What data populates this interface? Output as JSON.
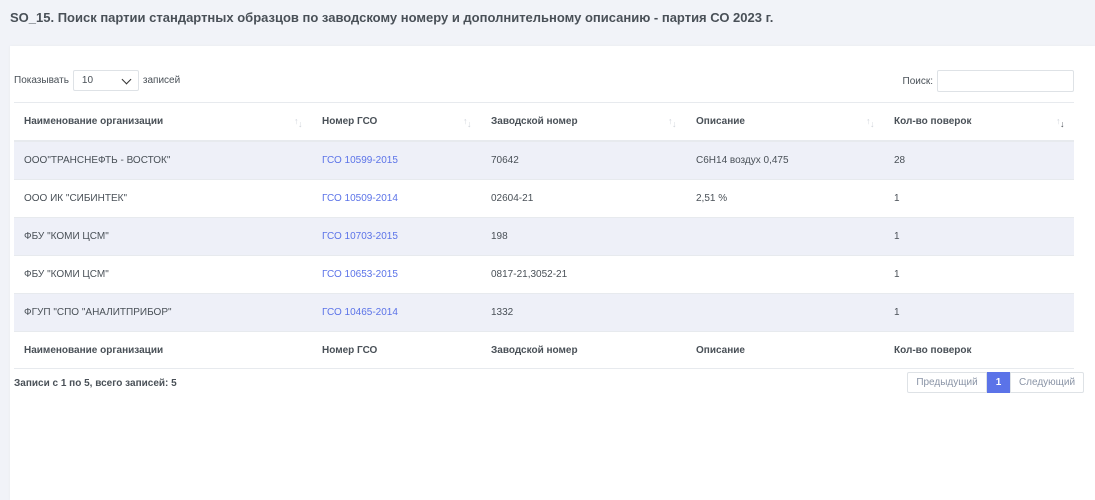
{
  "page": {
    "title": "SO_15. Поиск партии стандартных образцов по заводскому номеру и дополнительному описанию - партия СО 2023 г."
  },
  "length": {
    "prefix": "Показывать",
    "value": "10",
    "suffix": "записей"
  },
  "search": {
    "label": "Поиск:",
    "value": ""
  },
  "table": {
    "columns": [
      "Наименование организации",
      "Номер ГСО",
      "Заводской номер",
      "Описание",
      "Кол-во поверок"
    ],
    "rows": [
      [
        "ООО\"ТРАНСНЕФТЬ - ВОСТОК\"",
        "ГСО 10599-2015",
        "70642",
        "C6H14 воздух 0,475",
        "28"
      ],
      [
        "ООО ИК \"СИБИНТЕК\"",
        "ГСО 10509-2014",
        "02604-21",
        "2,51 %",
        "1"
      ],
      [
        "ФБУ \"КОМИ ЦСМ\"",
        "ГСО 10703-2015",
        "198",
        "",
        "1"
      ],
      [
        "ФБУ \"КОМИ ЦСМ\"",
        "ГСО 10653-2015",
        "0817-21,3052-21",
        "",
        "1"
      ],
      [
        "ФГУП \"СПО \"АНАЛИТПРИБОР\"",
        "ГСО 10465-2014",
        "1332",
        "",
        "1"
      ]
    ]
  },
  "info": "Записи с 1 по 5, всего записей: 5",
  "pagination": {
    "previous": "Предыдущий",
    "current": "1",
    "next": "Следующий"
  },
  "colors": {
    "accent": "#5b73e8",
    "stripe": "#eef0f8",
    "background": "#f1f3f8"
  }
}
